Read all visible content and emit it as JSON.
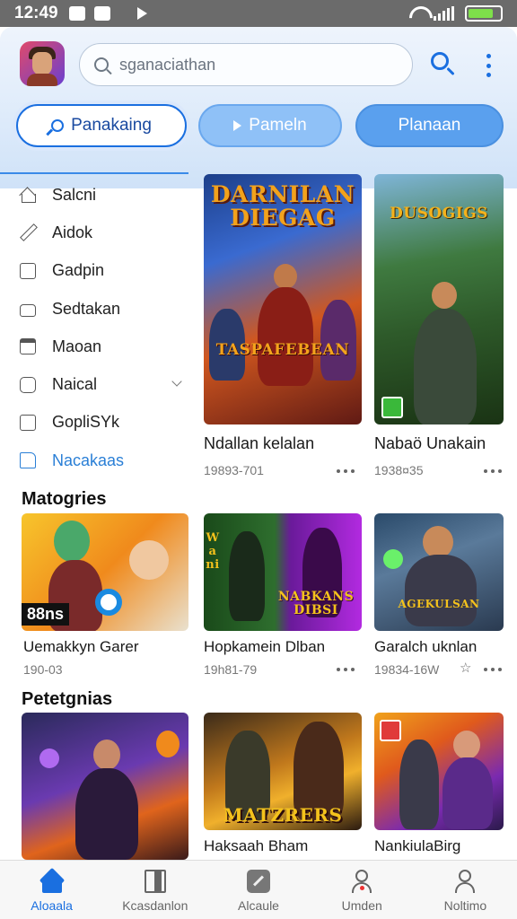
{
  "status_bar": {
    "time": "12:49"
  },
  "header": {
    "search_placeholder": "sganaciathan",
    "tabs": [
      {
        "label": "Panakaing",
        "icon": "search-key-icon",
        "active": true
      },
      {
        "label": "Pameln",
        "icon": "play-icon",
        "active": false
      },
      {
        "label": "Planaan",
        "icon": "",
        "active": false
      }
    ]
  },
  "sidebar": {
    "items": [
      {
        "label": "Salcni",
        "icon": "home-icon"
      },
      {
        "label": "Aidok",
        "icon": "edit-icon"
      },
      {
        "label": "Gadpin",
        "icon": "square-icon"
      },
      {
        "label": "Sedtakan",
        "icon": "hand-icon"
      },
      {
        "label": "Maoan",
        "icon": "window-icon"
      },
      {
        "label": "Naical",
        "icon": "card-icon",
        "expandable": true
      },
      {
        "label": "GopliSYk",
        "icon": "image-icon"
      },
      {
        "label": "Nacakaas",
        "icon": "note-icon",
        "active": true
      }
    ]
  },
  "featured": [
    {
      "title": "Ndallan kelalan",
      "meta": "19893-701",
      "art_title": "DARNILAN DIEGAG",
      "art_subtitle": "TASPAFEBEAN"
    },
    {
      "title": "Nabaö Unakain",
      "meta": "1938¤35",
      "art_title": "DUSOGIGS"
    }
  ],
  "sections": {
    "matogries": {
      "title": "Matogries",
      "cards": [
        {
          "title": "Uemakkyn Garer",
          "meta": "190-03",
          "art_label": "88ns"
        },
        {
          "title": "Hopkamein Dlban",
          "meta": "19h81-79",
          "art_title": "NABKANS DIBSI",
          "art_side": "Wani"
        },
        {
          "title": "Garalch uknlan",
          "meta": "19834-16W",
          "art_title": "AGEKULSAN"
        }
      ]
    },
    "petetgnias": {
      "title": "Petetgnias",
      "cards": [
        {
          "title": ""
        },
        {
          "title": "Haksaah Bham",
          "art_title": "MATZRERS"
        },
        {
          "title": "NankiulaBirg"
        }
      ]
    }
  },
  "bottom_nav": [
    {
      "label": "Aloaala",
      "icon": "home-icon",
      "active": true
    },
    {
      "label": "Kcasdanlon",
      "icon": "book-icon"
    },
    {
      "label": "Alcaule",
      "icon": "game-icon"
    },
    {
      "label": "Umden",
      "icon": "person-alert-icon"
    },
    {
      "label": "Noltimo",
      "icon": "person-icon"
    }
  ],
  "colors": {
    "accent": "#1a6fe0",
    "active_link": "#2a7fd6"
  }
}
